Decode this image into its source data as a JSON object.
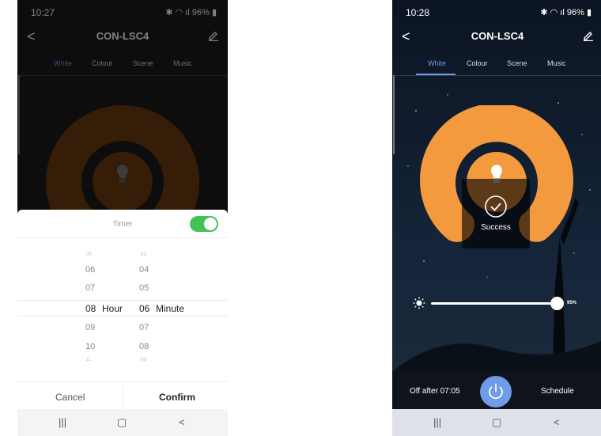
{
  "left_screen": {
    "status": {
      "time": "10:27",
      "battery": "96%"
    },
    "app_title": "CON-LSC4",
    "tabs": [
      "White",
      "Colour",
      "Scene",
      "Music"
    ],
    "active_tab": "White",
    "timer": {
      "title": "Timer",
      "enabled": true,
      "hour_column": [
        "05",
        "06",
        "07",
        "08",
        "09",
        "10",
        "11"
      ],
      "minute_column": [
        "03",
        "04",
        "05",
        "06",
        "07",
        "08",
        "09"
      ],
      "selected_hour": "08",
      "selected_minute": "06",
      "hour_unit": "Hour",
      "minute_unit": "Minute",
      "cancel_label": "Cancel",
      "confirm_label": "Confirm"
    },
    "colors": {
      "dial": "#6a3a0f",
      "toggle": "#43c25c"
    }
  },
  "right_screen": {
    "status": {
      "time": "10:28",
      "battery": "96%"
    },
    "app_title": "CON-LSC4",
    "tabs": [
      "White",
      "Colour",
      "Scene",
      "Music"
    ],
    "active_tab": "White",
    "success_text": "Success",
    "brightness": {
      "value": 0.95,
      "label": "95%"
    },
    "off_after": "Off after 07:05",
    "schedule_label": "Schedule",
    "colors": {
      "dial": "#f39a3e",
      "accent": "#6e9ce8"
    }
  },
  "navbar": {
    "recent": "|||",
    "home": "▢",
    "back": "<"
  }
}
